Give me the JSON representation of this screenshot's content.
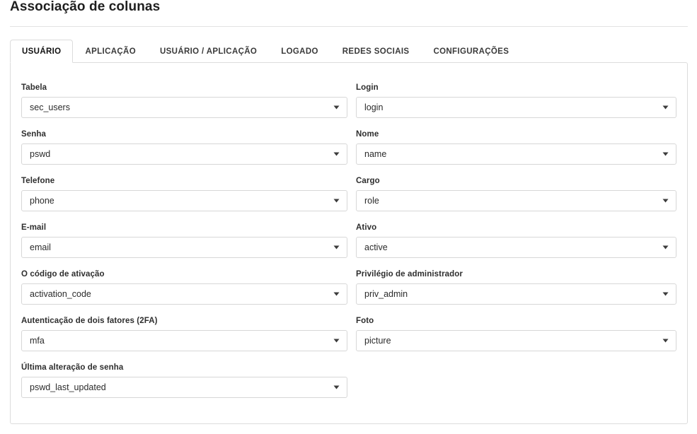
{
  "page": {
    "title": "Associação de colunas"
  },
  "tabs": [
    {
      "label": "USUÁRIO",
      "active": true,
      "name": "tab-usuario"
    },
    {
      "label": "APLICAÇÃO",
      "active": false,
      "name": "tab-aplicacao"
    },
    {
      "label": "USUÁRIO / APLICAÇÃO",
      "active": false,
      "name": "tab-usuario-aplicacao"
    },
    {
      "label": "LOGADO",
      "active": false,
      "name": "tab-logado"
    },
    {
      "label": "REDES SOCIAIS",
      "active": false,
      "name": "tab-redes-sociais"
    },
    {
      "label": "CONFIGURAÇÕES",
      "active": false,
      "name": "tab-configuracoes"
    }
  ],
  "form": {
    "left_column": [
      {
        "label": "Tabela",
        "value": "sec_users",
        "name": "tabela"
      },
      {
        "label": "Senha",
        "value": "pswd",
        "name": "senha"
      },
      {
        "label": "Telefone",
        "value": "phone",
        "name": "telefone"
      },
      {
        "label": "E-mail",
        "value": "email",
        "name": "email"
      },
      {
        "label": "O código de ativação",
        "value": "activation_code",
        "name": "codigo-ativacao"
      },
      {
        "label": "Autenticação de dois fatores (2FA)",
        "value": "mfa",
        "name": "autenticacao-2fa"
      },
      {
        "label": "Última alteração de senha",
        "value": "pswd_last_updated",
        "name": "ultima-alteracao-senha"
      }
    ],
    "right_column": [
      {
        "label": "Login",
        "value": "login",
        "name": "login"
      },
      {
        "label": "Nome",
        "value": "name",
        "name": "nome"
      },
      {
        "label": "Cargo",
        "value": "role",
        "name": "cargo"
      },
      {
        "label": "Ativo",
        "value": "active",
        "name": "ativo"
      },
      {
        "label": "Privilégio de administrador",
        "value": "priv_admin",
        "name": "privilegio-administrador"
      },
      {
        "label": "Foto",
        "value": "picture",
        "name": "foto"
      }
    ]
  },
  "icons": {
    "dropdown": "chevron-down-icon"
  },
  "colors": {
    "border": "#dcdcdc",
    "field_border": "#d7d7d7",
    "text": "#2b2b2b",
    "label": "#2e2e2e",
    "background": "#ffffff"
  }
}
